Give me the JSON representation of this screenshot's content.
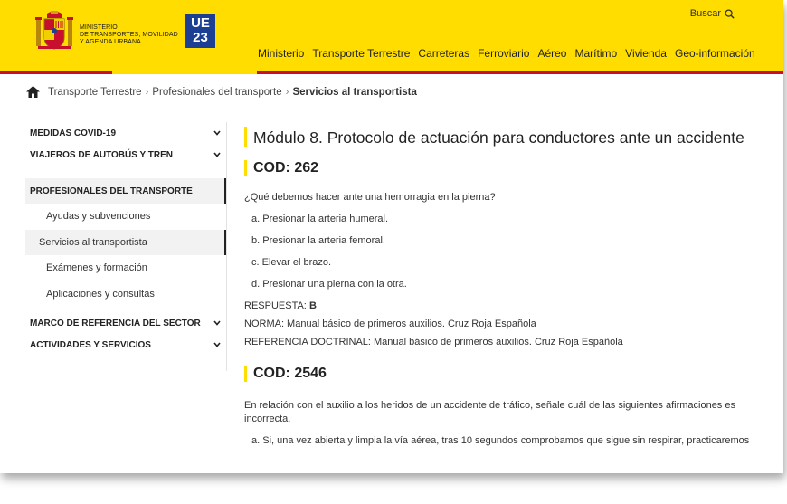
{
  "header": {
    "ministry_line1": "Ministerio",
    "ministry_line2": "de Transportes, Movilidad",
    "ministry_line3": "y Agenda Urbana",
    "badge_top": "UE",
    "badge_bottom": "23",
    "search_label": "Buscar",
    "nav": [
      "Ministerio",
      "Transporte Terrestre",
      "Carreteras",
      "Ferroviario",
      "Aéreo",
      "Marítimo",
      "Vivienda",
      "Geo-información"
    ],
    "colors": {
      "yellow": "#ffdd00",
      "red": "#c8102e",
      "eu_blue": "#1c3f94"
    }
  },
  "breadcrumb": {
    "home_icon": "home-icon",
    "items": [
      "Transporte Terrestre",
      "Profesionales del transporte"
    ],
    "current": "Servicios al transportista"
  },
  "sidebar": {
    "top_items": [
      "Medidas COVID-19",
      "Viajeros de autobús y tren"
    ],
    "active_section": "Profesionales del transporte",
    "sub_items": [
      "Ayudas y subvenciones",
      "Servicios al transportista",
      "Exámenes y formación",
      "Aplicaciones y consultas"
    ],
    "active_sub": "Servicios al transportista",
    "bottom_items": [
      "Marco de referencia del sector",
      "Actividades y servicios"
    ]
  },
  "main": {
    "title": "Módulo 8. Protocolo de actuación para conductores ante un accidente",
    "q1": {
      "code": "COD: 262",
      "question": "¿Qué debemos hacer ante una hemorragia en la pierna?",
      "options": [
        "a. Presionar la arteria humeral.",
        "b. Presionar la arteria femoral.",
        "c. Elevar el brazo.",
        "d. Presionar una pierna con la otra."
      ],
      "answer_label": "RESPUESTA:",
      "answer_value": "B",
      "norma": "NORMA: Manual básico de primeros auxilios. Cruz Roja Española",
      "referencia": "REFERENCIA DOCTRINAL: Manual básico de primeros auxilios. Cruz Roja Española"
    },
    "q2": {
      "code": "COD: 2546",
      "question": "En relación con el auxilio a los heridos de un accidente de tráfico, señale cuál de las siguientes afirmaciones es incorrecta.",
      "option_a": "a. Si, una vez abierta y limpia la vía aérea, tras 10 segundos comprobamos que sigue sin respirar, practicaremos"
    }
  }
}
